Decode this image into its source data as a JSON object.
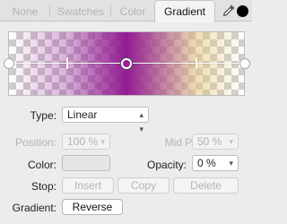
{
  "tabs": [
    {
      "label": "None",
      "active": false
    },
    {
      "label": "Swatches",
      "active": false
    },
    {
      "label": "Color",
      "active": false
    },
    {
      "label": "Gradient",
      "active": true
    }
  ],
  "current_color": "#000000",
  "gradient": {
    "start_color": "#921b92",
    "end_color": "#f0dca0"
  },
  "type": {
    "label": "Type:",
    "value": "Linear"
  },
  "position": {
    "label": "Position:",
    "value": "100 %",
    "enabled": false
  },
  "mid_point": {
    "label": "Mid Point:",
    "value": "50 %",
    "enabled": false
  },
  "color": {
    "label": "Color:"
  },
  "opacity": {
    "label": "Opacity:",
    "value": "0 %"
  },
  "stop": {
    "label": "Stop:",
    "insert": "Insert",
    "copy": "Copy",
    "delete": "Delete"
  },
  "gradient_row": {
    "label": "Gradient:",
    "reverse": "Reverse"
  }
}
